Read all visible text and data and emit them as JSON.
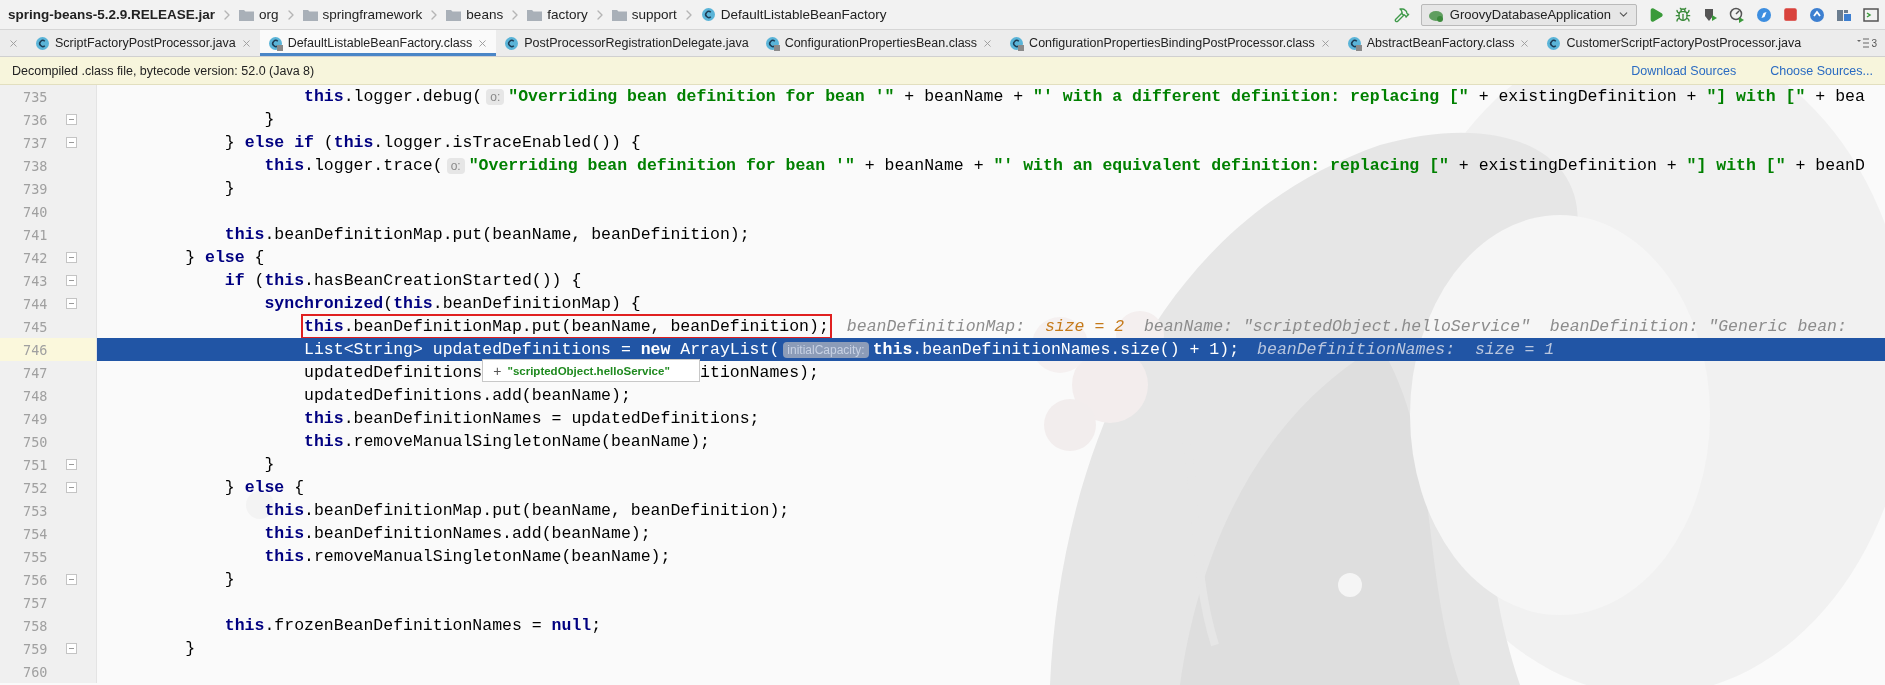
{
  "breadcrumb": {
    "archive": "spring-beans-5.2.9.RELEASE.jar",
    "items": [
      {
        "kind": "folder",
        "label": "org"
      },
      {
        "kind": "folder",
        "label": "springframework"
      },
      {
        "kind": "folder",
        "label": "beans"
      },
      {
        "kind": "folder",
        "label": "factory"
      },
      {
        "kind": "folder",
        "label": "support"
      },
      {
        "kind": "class",
        "label": "DefaultListableBeanFactory"
      }
    ]
  },
  "run_config": {
    "label": "GroovyDatabaseApplication"
  },
  "tabs": {
    "items": [
      {
        "kind": "cut",
        "closable": true,
        "selected": false
      },
      {
        "kind": "java",
        "label": "ScriptFactoryPostProcessor.java",
        "closable": true,
        "selected": false
      },
      {
        "kind": "class",
        "label": "DefaultListableBeanFactory.class",
        "closable": true,
        "selected": true
      },
      {
        "kind": "java",
        "label": "PostProcessorRegistrationDelegate.java",
        "closable": false,
        "selected": false
      },
      {
        "kind": "class",
        "label": "ConfigurationPropertiesBean.class",
        "closable": true,
        "selected": false
      },
      {
        "kind": "class",
        "label": "ConfigurationPropertiesBindingPostProcessor.class",
        "closable": true,
        "selected": false
      },
      {
        "kind": "class",
        "label": "AbstractBeanFactory.class",
        "closable": true,
        "selected": false
      },
      {
        "kind": "java",
        "label": "CustomerScriptFactoryPostProcessor.java",
        "closable": false,
        "selected": false
      }
    ],
    "overflow_count": "3"
  },
  "notice": {
    "text": "Decompiled .class file, bytecode version: 52.0 (Java 8)",
    "links": [
      "Download Sources",
      "Choose Sources..."
    ]
  },
  "editor": {
    "lines": [
      {
        "children": [
          {
            "children": [
              {
                "children": [
                  {
                    "number": "735",
                    "fold": false,
                    "selected": false,
                    "segments": [
                      {
                        "kind": "code",
                        "tokens": [
                          {
                            "kind": "kw",
                            "text": "this"
                          },
                          {
                            "kind": "plain",
                            "text": ".logger.debug("
                          }
                        ]
                      },
                      {
                        "kind": "hint",
                        "text": "o:"
                      },
                      {
                        "kind": "code",
                        "tokens": [
                          {
                            "kind": "str",
                            "text": "\"Overriding bean definition for bean '\""
                          },
                          {
                            "kind": "plain",
                            "text": " + beanName + "
                          },
                          {
                            "kind": "str",
                            "text": "\"' with a different definition: replacing [\""
                          },
                          {
                            "kind": "plain",
                            "text": " + existingDefinition + "
                          },
                          {
                            "kind": "str",
                            "text": "\"] with [\""
                          },
                          {
                            "kind": "plain",
                            "text": " + bea"
                          }
                        ]
                      }
                    ]
                  }
                ]
              },
              {
                "number": "736",
                "fold": true,
                "selected": false,
                "segments": [
                  {
                    "kind": "code",
                    "tokens": [
                      {
                        "kind": "plain",
                        "text": "}"
                      }
                    ]
                  }
                ]
              }
            ]
          },
          {
            "number": "737",
            "fold": true,
            "selected": false,
            "segments": [
              {
                "kind": "code",
                "tokens": [
                  {
                    "kind": "plain",
                    "text": "} "
                  },
                  {
                    "kind": "kw",
                    "text": "else if"
                  },
                  {
                    "kind": "plain",
                    "text": " ("
                  },
                  {
                    "kind": "kw",
                    "text": "this"
                  },
                  {
                    "kind": "plain",
                    "text": ".logger.isTraceEnabled()) {"
                  }
                ]
              }
            ],
            "children": [
              {
                "number": "738",
                "fold": false,
                "selected": false,
                "segments": [
                  {
                    "kind": "code",
                    "tokens": [
                      {
                        "kind": "kw",
                        "text": "this"
                      },
                      {
                        "kind": "plain",
                        "text": ".logger.trace("
                      }
                    ]
                  },
                  {
                    "kind": "hint",
                    "text": "o:"
                  },
                  {
                    "kind": "code",
                    "tokens": [
                      {
                        "kind": "str",
                        "text": "\"Overriding bean definition for bean '\""
                      },
                      {
                        "kind": "plain",
                        "text": " + beanName + "
                      },
                      {
                        "kind": "str",
                        "text": "\"' with an equivalent definition: replacing [\""
                      },
                      {
                        "kind": "plain",
                        "text": " + existingDefinition + "
                      },
                      {
                        "kind": "str",
                        "text": "\"] with [\""
                      },
                      {
                        "kind": "plain",
                        "text": " + beanD"
                      }
                    ]
                  }
                ]
              }
            ]
          },
          {
            "number": "739",
            "fold": false,
            "selected": false,
            "segments": [
              {
                "kind": "code",
                "tokens": [
                  {
                    "kind": "plain",
                    "text": "}"
                  }
                ]
              }
            ]
          },
          {
            "number": "740",
            "fold": false,
            "selected": false
          },
          {
            "number": "741",
            "fold": false,
            "selected": false,
            "segments": [
              {
                "kind": "code",
                "tokens": [
                  {
                    "kind": "kw",
                    "text": "this"
                  },
                  {
                    "kind": "plain",
                    "text": ".beanDefinitionMap.put(beanName, beanDefinition);"
                  }
                ]
              }
            ]
          }
        ]
      },
      {
        "number": "742",
        "fold": true,
        "selected": false,
        "segments": [
          {
            "kind": "code",
            "tokens": [
              {
                "kind": "plain",
                "text": "} "
              },
              {
                "kind": "kw",
                "text": "else"
              },
              {
                "kind": "plain",
                "text": " {"
              }
            ]
          }
        ],
        "children": [
          {
            "number": "743",
            "fold": true,
            "selected": false,
            "segments": [
              {
                "kind": "code",
                "tokens": [
                  {
                    "kind": "kw",
                    "text": "if"
                  },
                  {
                    "kind": "plain",
                    "text": " ("
                  },
                  {
                    "kind": "kw",
                    "text": "this"
                  },
                  {
                    "kind": "plain",
                    "text": ".hasBeanCreationStarted()) {"
                  }
                ]
              }
            ],
            "children": [
              {
                "number": "744",
                "fold": true,
                "selected": false,
                "segments": [
                  {
                    "kind": "code",
                    "tokens": [
                      {
                        "kind": "kw",
                        "text": "synchronized"
                      },
                      {
                        "kind": "plain",
                        "text": "("
                      },
                      {
                        "kind": "kw",
                        "text": "this"
                      },
                      {
                        "kind": "plain",
                        "text": ".beanDefinitionMap) {"
                      }
                    ]
                  }
                ],
                "children": [
                  {
                    "number": "745",
                    "fold": false,
                    "selected": false,
                    "segments": [
                      {
                        "kind": "framed",
                        "tokens": [
                          {
                            "kind": "kw",
                            "text": "this"
                          },
                          {
                            "kind": "plain",
                            "text": ".beanDefinitionMap.put(beanName, beanDefinition);"
                          }
                        ]
                      },
                      {
                        "kind": "inline",
                        "tokens": [
                          {
                            "kind": "debug",
                            "text": "beanDefinitionMap:  "
                          },
                          {
                            "kind": "size",
                            "text": "size = 2"
                          },
                          {
                            "kind": "debug",
                            "text": "  beanName: \"scriptedObject.helloService\"  beanDefinition: \"Generic bean:"
                          }
                        ]
                      }
                    ]
                  },
                  {
                    "number": "746",
                    "fold": false,
                    "selected": true,
                    "segments": [
                      {
                        "kind": "code",
                        "tokens": [
                          {
                            "kind": "plain",
                            "text": "List<String> updatedDefinitions = "
                          },
                          {
                            "kind": "kw",
                            "text": "new"
                          },
                          {
                            "kind": "plain",
                            "text": " ArrayList("
                          }
                        ]
                      },
                      {
                        "kind": "hint",
                        "text": "initialCapacity:"
                      },
                      {
                        "kind": "code",
                        "tokens": [
                          {
                            "kind": "kw",
                            "text": "this"
                          },
                          {
                            "kind": "plain",
                            "text": ".beanDefinitionNames.size() + 1);"
                          }
                        ]
                      },
                      {
                        "kind": "inline",
                        "tokens": [
                          {
                            "kind": "debug",
                            "text": "beanDefinitionNames:  "
                          },
                          {
                            "kind": "size",
                            "text": "size = 1"
                          }
                        ]
                      }
                    ]
                  },
                  {
                    "number": "747",
                    "fold": false,
                    "selected": false,
                    "segments": [
                      {
                        "kind": "code",
                        "tokens": [
                          {
                            "kind": "plain",
                            "text": "updatedDefinitions"
                          }
                        ]
                      },
                      {
                        "kind": "popup",
                        "sign": "+",
                        "text": "\"scriptedObject.helloService\""
                      },
                      {
                        "kind": "code",
                        "tokens": [
                          {
                            "kind": "plain",
                            "text": "itionNames);"
                          }
                        ]
                      }
                    ]
                  },
                  {
                    "number": "748",
                    "fold": false,
                    "selected": false,
                    "segments": [
                      {
                        "kind": "code",
                        "tokens": [
                          {
                            "kind": "plain",
                            "text": "updatedDefinitions.add(beanName);"
                          }
                        ]
                      }
                    ]
                  },
                  {
                    "number": "749",
                    "fold": false,
                    "selected": false,
                    "segments": [
                      {
                        "kind": "code",
                        "tokens": [
                          {
                            "kind": "kw",
                            "text": "this"
                          },
                          {
                            "kind": "plain",
                            "text": ".beanDefinitionNames = updatedDefinitions;"
                          }
                        ]
                      }
                    ]
                  },
                  {
                    "number": "750",
                    "fold": false,
                    "selected": false,
                    "segments": [
                      {
                        "kind": "code",
                        "tokens": [
                          {
                            "kind": "kw",
                            "text": "this"
                          },
                          {
                            "kind": "plain",
                            "text": ".removeManualSingletonName(beanName);"
                          }
                        ]
                      }
                    ]
                  }
                ]
              },
              {
                "number": "751",
                "fold": true,
                "selected": false,
                "segments": [
                  {
                    "kind": "code",
                    "tokens": [
                      {
                        "kind": "plain",
                        "text": "}"
                      }
                    ]
                  }
                ]
              }
            ]
          },
          {
            "number": "752",
            "fold": true,
            "selected": false,
            "segments": [
              {
                "kind": "code",
                "tokens": [
                  {
                    "kind": "plain",
                    "text": "} "
                  },
                  {
                    "kind": "kw",
                    "text": "else"
                  },
                  {
                    "kind": "plain",
                    "text": " {"
                  }
                ]
              }
            ],
            "children": [
              {
                "number": "753",
                "fold": false,
                "selected": false,
                "segments": [
                  {
                    "kind": "code",
                    "tokens": [
                      {
                        "kind": "kw",
                        "text": "this"
                      },
                      {
                        "kind": "plain",
                        "text": ".beanDefinitionMap.put(beanName, beanDefinition);"
                      }
                    ]
                  }
                ]
              },
              {
                "number": "754",
                "fold": false,
                "selected": false,
                "segments": [
                  {
                    "kind": "code",
                    "tokens": [
                      {
                        "kind": "kw",
                        "text": "this"
                      },
                      {
                        "kind": "plain",
                        "text": ".beanDefinitionNames.add(beanName);"
                      }
                    ]
                  }
                ]
              },
              {
                "number": "755",
                "fold": false,
                "selected": false,
                "segments": [
                  {
                    "kind": "code",
                    "tokens": [
                      {
                        "kind": "kw",
                        "text": "this"
                      },
                      {
                        "kind": "plain",
                        "text": ".removeManualSingletonName(beanName);"
                      }
                    ]
                  }
                ]
              }
            ]
          },
          {
            "number": "756",
            "fold": true,
            "selected": false,
            "segments": [
              {
                "kind": "code",
                "tokens": [
                  {
                    "kind": "plain",
                    "text": "}"
                  }
                ]
              }
            ]
          },
          {
            "number": "757",
            "fold": false,
            "selected": false
          },
          {
            "number": "758",
            "fold": false,
            "selected": false,
            "segments": [
              {
                "kind": "code",
                "tokens": [
                  {
                    "kind": "kw",
                    "text": "this"
                  },
                  {
                    "kind": "plain",
                    "text": ".frozenBeanDefinitionNames = "
                  },
                  {
                    "kind": "kw",
                    "text": "null"
                  },
                  {
                    "kind": "plain",
                    "text": ";"
                  }
                ]
              }
            ]
          }
        ]
      },
      {
        "number": "759",
        "fold": true,
        "selected": false,
        "segments": [
          {
            "kind": "code",
            "tokens": [
              {
                "kind": "plain",
                "text": "}"
              }
            ]
          }
        ]
      },
      {
        "number": "760",
        "fold": false,
        "selected": false
      }
    ]
  }
}
